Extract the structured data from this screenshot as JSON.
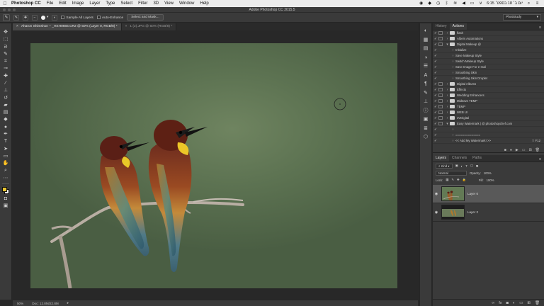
{
  "menubar": {
    "app": "Photoshop CC",
    "items": [
      "File",
      "Edit",
      "Image",
      "Layer",
      "Type",
      "Select",
      "Filter",
      "3D",
      "View",
      "Window",
      "Help"
    ],
    "clock": "6:15 יום ב׳ 18 בספט׳"
  },
  "window": {
    "title": "Adobe Photoshop CC 2015.5"
  },
  "options": {
    "sample_all_layers": "Sample All Layers",
    "auto_enhance": "Auto-Enhance",
    "select_and_mask": "Select and Mask...",
    "workspace": "PhotStudy"
  },
  "tabs": [
    {
      "label": "Aharon Shimshon – _HSH0665.CR2 @ 50% (Layer 0, RGB/8) *"
    },
    {
      "label": "1 (2).JPG @ 50% (RGB/8) *"
    }
  ],
  "status": {
    "zoom": "50%",
    "doc": "Doc: 12.8M/22.8M"
  },
  "panels": {
    "top_tabs": [
      "History",
      "Actions"
    ],
    "actions": [
      {
        "label": "flash",
        "folder": true
      },
      {
        "label": "Albers Automations",
        "folder": true
      },
      {
        "label": "Digital Makeup @",
        "folder": true,
        "open": true
      },
      {
        "label": "Initialize",
        "indent": true
      },
      {
        "label": "Save Makeup Style",
        "indent": true
      },
      {
        "label": "Switch Makeup Style",
        "indent": true
      },
      {
        "label": "Save Image For e-mail",
        "indent": true
      },
      {
        "label": "Smoothing Skin",
        "indent": true
      },
      {
        "label": "Smoothing Skin Droplet",
        "indent": true
      },
      {
        "label": "Digital Albums",
        "folder": true
      },
      {
        "label": "Effects",
        "folder": true
      },
      {
        "label": "Wedding Enhancers",
        "folder": true
      },
      {
        "label": "Midtown TEMP",
        "folder": true
      },
      {
        "label": "TEMP",
        "folder": true
      },
      {
        "label": "WEB UI",
        "folder": true
      },
      {
        "label": "3VDigital",
        "folder": true
      },
      {
        "label": "Easy Watermark | @ photoshopchef.com",
        "folder": true,
        "open": true
      },
      {
        "label": "",
        "indent": true
      },
      {
        "label": "==============",
        "indent": true
      },
      {
        "label": "<< Add My Watermark! >>",
        "indent": true,
        "shortcut": "⇧ F12"
      }
    ],
    "layer_tabs": [
      "Layers",
      "Channels",
      "Paths"
    ],
    "kind": "Kind",
    "blend_mode": "Normal",
    "opacity_label": "Opacity:",
    "opacity": "100%",
    "lock_label": "Lock:",
    "fill_label": "Fill:",
    "fill": "100%",
    "layers": [
      {
        "name": "Layer 0",
        "selected": true
      },
      {
        "name": "Layer 2",
        "selected": false
      }
    ]
  }
}
